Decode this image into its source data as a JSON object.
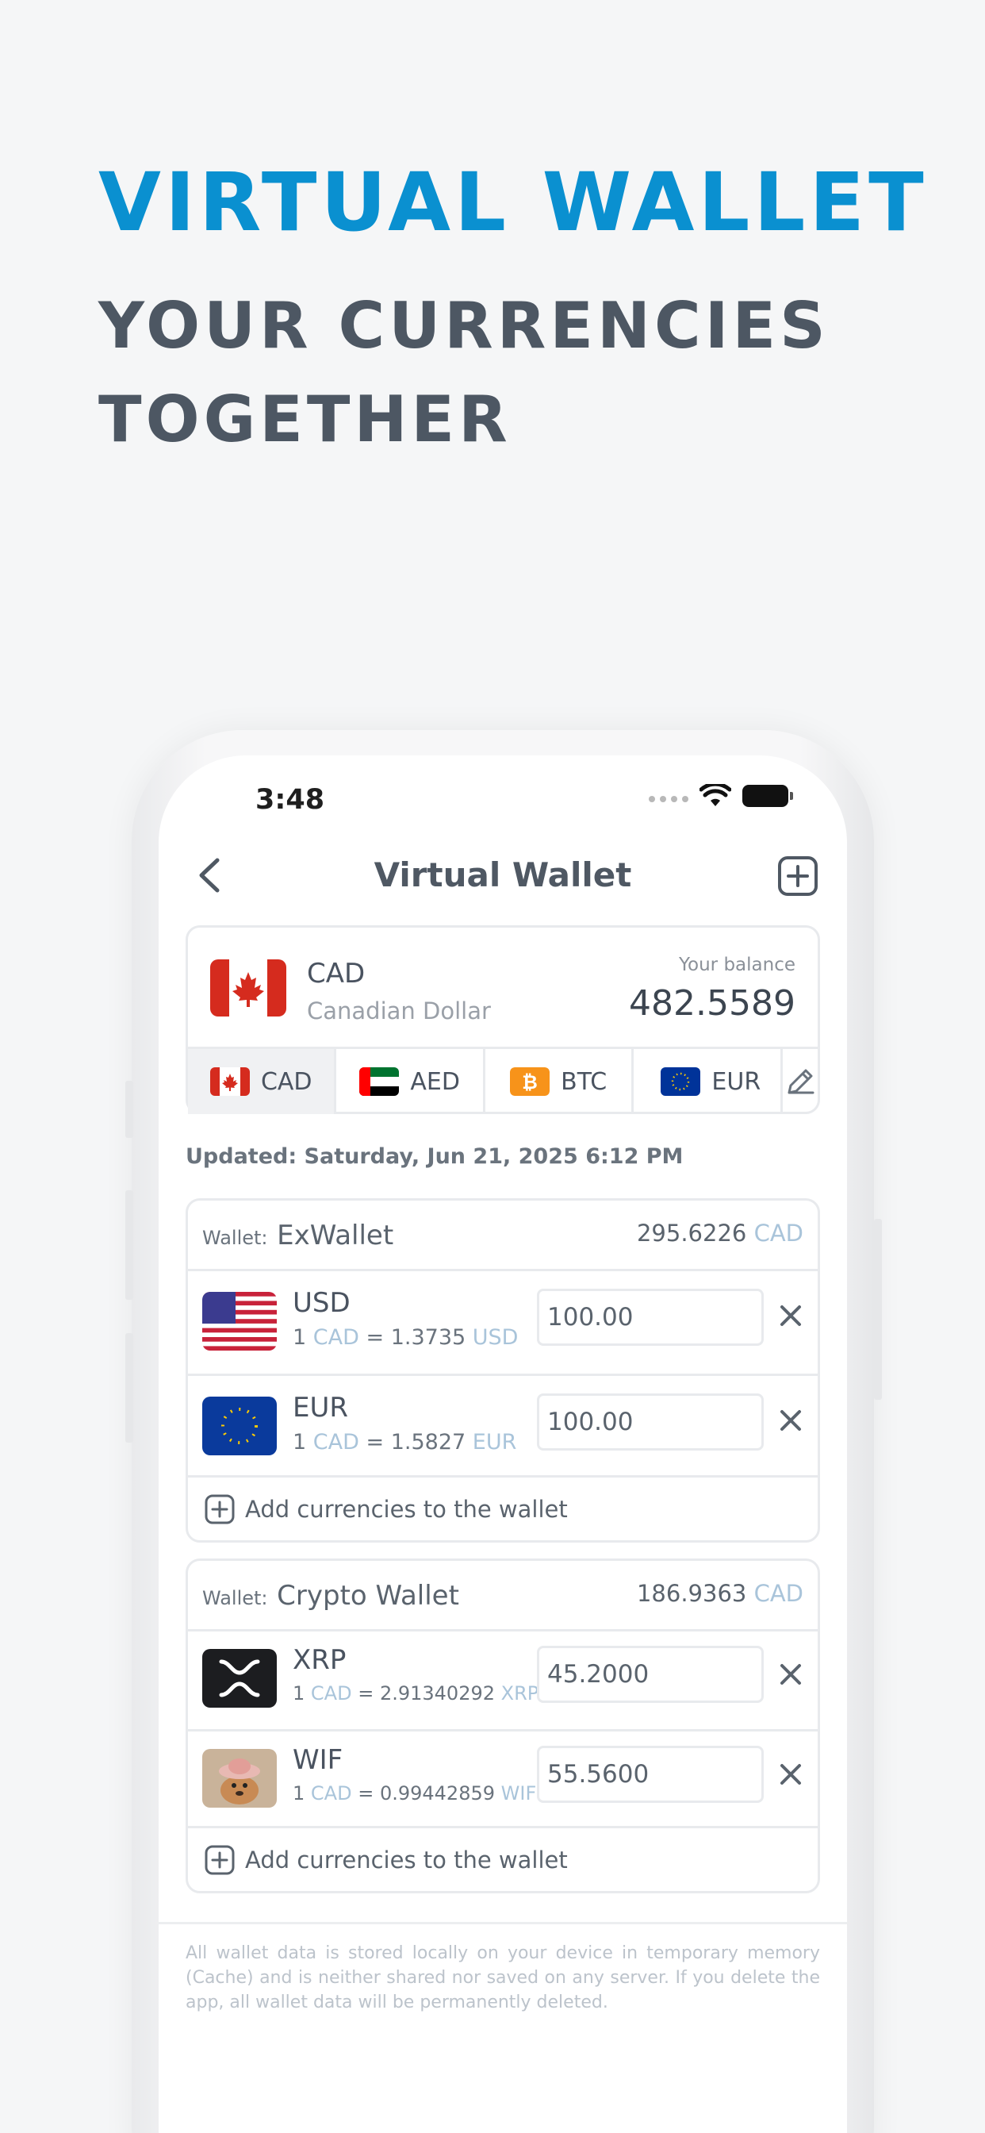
{
  "hero": {
    "title": "VIRTUAL WALLET",
    "subtitle_line1": "YOUR CURRENCIES",
    "subtitle_line2": "TOGETHER"
  },
  "status_bar": {
    "time": "3:48"
  },
  "nav": {
    "title": "Virtual Wallet",
    "back_icon": "chevron-left-icon",
    "add_icon": "plus-square-icon"
  },
  "balance": {
    "code": "CAD",
    "name": "Canadian Dollar",
    "label": "Your balance",
    "value": "482.5589"
  },
  "tabs": [
    {
      "label": "CAD",
      "icon": "flag-ca"
    },
    {
      "label": "AED",
      "icon": "flag-ae"
    },
    {
      "label": "BTC",
      "icon": "bitcoin-icon"
    },
    {
      "label": "EUR",
      "icon": "flag-eu"
    }
  ],
  "updated": "Updated: Saturday, Jun 21, 2025 6:12 PM",
  "wallets": [
    {
      "prefix": "Wallet:",
      "name": "ExWallet",
      "total": "295.6226",
      "total_unit": "CAD",
      "items": [
        {
          "code": "USD",
          "rate_left": "1",
          "rate_base": "CAD",
          "rate_eq": "= 1.3735",
          "rate_quote": "USD",
          "amount": "100.00"
        },
        {
          "code": "EUR",
          "rate_left": "1",
          "rate_base": "CAD",
          "rate_eq": "= 1.5827",
          "rate_quote": "EUR",
          "amount": "100.00"
        }
      ],
      "add_label": "Add currencies to the wallet"
    },
    {
      "prefix": "Wallet:",
      "name": "Crypto Wallet",
      "total": "186.9363",
      "total_unit": "CAD",
      "items": [
        {
          "code": "XRP",
          "rate_left": "1",
          "rate_base": "CAD",
          "rate_eq": "= 2.91340292",
          "rate_quote": "XRP",
          "amount": "45.2000"
        },
        {
          "code": "WIF",
          "rate_left": "1",
          "rate_base": "CAD",
          "rate_eq": "= 0.99442859",
          "rate_quote": "WIF",
          "amount": "55.5600"
        }
      ],
      "add_label": "Add currencies to the wallet"
    }
  ],
  "disclaimer": "All wallet data is stored locally on your device in temporary memory (Cache) and is neither shared nor saved on any server. If you delete the app, all wallet data will be permanently deleted.",
  "colors": {
    "accent": "#0a90d0",
    "heading": "#4d5763",
    "muted_unit": "#a9c4da"
  }
}
